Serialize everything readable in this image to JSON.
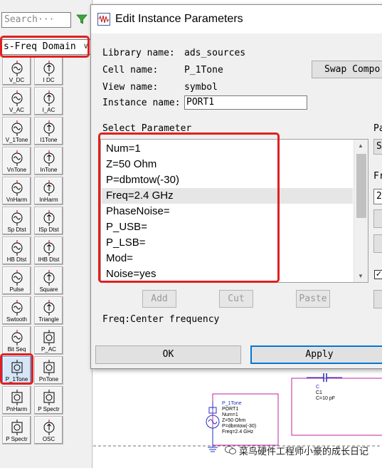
{
  "palette": {
    "search_placeholder": "Search···",
    "domain_selected": "s-Freq Domain",
    "items": [
      {
        "label": "V_DC",
        "kind": "vsrc"
      },
      {
        "label": "I DC",
        "kind": "isrc"
      },
      {
        "label": "V_AC",
        "kind": "vsrc"
      },
      {
        "label": "I_AC",
        "kind": "isrc"
      },
      {
        "label": "V_1Tone",
        "kind": "vsrc"
      },
      {
        "label": "I1Tone",
        "kind": "isrc"
      },
      {
        "label": "VnTone",
        "kind": "vsrc"
      },
      {
        "label": "InTone",
        "kind": "isrc"
      },
      {
        "label": "VnHarm",
        "kind": "vsrc"
      },
      {
        "label": "InHarm",
        "kind": "isrc"
      },
      {
        "label": "Sp Dtst",
        "kind": "vsrc",
        "prefix": "V"
      },
      {
        "label": "ISp Dtst",
        "kind": "isrc"
      },
      {
        "label": "HB Dtst",
        "kind": "vsrc",
        "prefix": "V"
      },
      {
        "label": "IHB Dtst",
        "kind": "isrc"
      },
      {
        "label": "Pulse",
        "kind": "vsrc"
      },
      {
        "label": "Square",
        "kind": "isrc"
      },
      {
        "label": "Swtooth",
        "kind": "vsrc"
      },
      {
        "label": "Triangle",
        "kind": "isrc"
      },
      {
        "label": "Bit Seq",
        "kind": "vsrc"
      },
      {
        "label": "P_AC",
        "kind": "port"
      },
      {
        "label": "P_1Tone",
        "kind": "port",
        "selected": true
      },
      {
        "label": "PnTone",
        "kind": "port"
      },
      {
        "label": "PnHarm",
        "kind": "port"
      },
      {
        "label": "P Spectr",
        "kind": "port",
        "badge": "D S"
      },
      {
        "label": "P Spectr",
        "kind": "port",
        "badge": "D S",
        "prefix": "F"
      },
      {
        "label": "OSC",
        "kind": "isrc"
      }
    ]
  },
  "dialog": {
    "title": "Edit Instance Parameters",
    "library_label": "Library name:",
    "library_value": "ads_sources",
    "cell_label": "Cell name:",
    "cell_value": "P_1Tone",
    "view_label": "View name:",
    "view_value": "symbol",
    "instance_label": "Instance name:",
    "instance_value": "PORT1",
    "swap_label": "Swap Compo",
    "select_param_label": "Select Parameter",
    "params": [
      "Num=1",
      "Z=50 Ohm",
      "P=dbmtow(-30)",
      "Freq=2.4 GHz",
      "PhaseNoise=",
      "P_USB=",
      "P_LSB=",
      "Mod=",
      "Noise=yes"
    ],
    "selected_index": 3,
    "add_label": "Add",
    "cut_label": "Cut",
    "paste_label": "Paste",
    "description": "Freq:Center frequency",
    "ok_label": "OK",
    "apply_label": "Apply",
    "right_partial": {
      "label1": "Pa",
      "btn1": "S",
      "label2": "Fr",
      "value2": "2"
    }
  },
  "schematic": {
    "port_lines": [
      "P_1Tone",
      "PORT1",
      "Num=1",
      "Z=50 Ohm",
      "P=dbmtow(-30)",
      "Freq=2.4 GHz"
    ],
    "cap_lines": [
      "C",
      "C1",
      "C=10 pF"
    ]
  },
  "watermark": "菜鸟硬件工程师小豪的成长日记",
  "colors": {
    "highlight": "#e02020",
    "accent": "#0078d7",
    "schematic_magenta": "#c020a0",
    "schematic_blue": "#2030c0"
  }
}
